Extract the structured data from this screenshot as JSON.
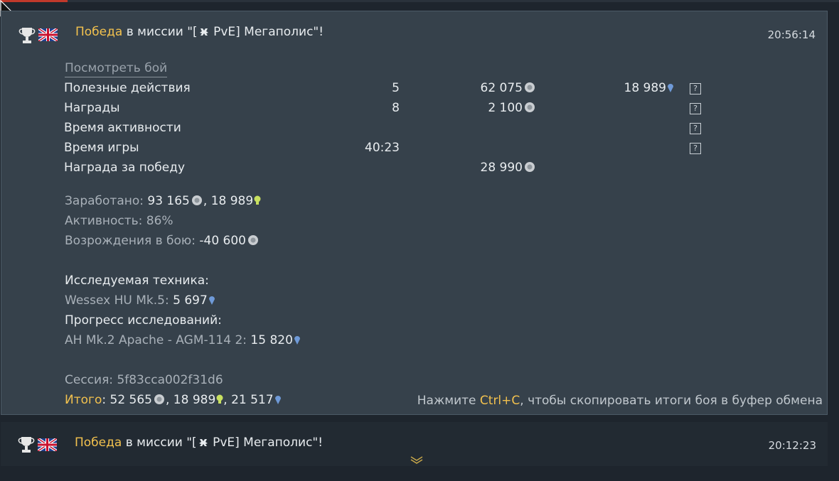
{
  "entry1": {
    "victory": "Победа",
    "mission_text": " в миссии \"[",
    "mission_name": " PvE] Мегаполис\"!",
    "time": "20:56:14",
    "view_battle": "Посмотреть бой",
    "rows": [
      {
        "label": "Полезные действия",
        "count": "5",
        "silver": "62 075",
        "rp": "18 989"
      },
      {
        "label": "Награды",
        "count": "8",
        "silver": "2 100",
        "rp": ""
      },
      {
        "label": "Время активности",
        "count": "",
        "silver": "",
        "rp": ""
      },
      {
        "label": "Время игры",
        "count": "40:23",
        "silver": "",
        "rp": ""
      },
      {
        "label": "Награда за победу",
        "count": "",
        "silver": "28 990",
        "rp": ""
      }
    ],
    "earned_label": "Заработано: ",
    "earned_silver": "93 165",
    "earned_rp": "18 989",
    "activity_label": "Активность: ",
    "activity_value": "86%",
    "respawn_label": "Возрождения в бою: ",
    "respawn_value": "-40 600",
    "research_title": "Исследуемая техника:",
    "research_vehicle": "Wessex HU Mk.5: ",
    "research_value": "5 697",
    "progress_title": "Прогресс исследований:",
    "progress_item": "AH Mk.2 Apache - AGM-114 2: ",
    "progress_value": "15 820",
    "session_label": "Сессия: ",
    "session_value": "5f83cca002f31d6",
    "total_label": "Итого",
    "total_silver": "52 565",
    "total_rp": "18 989",
    "total_crp": "21 517",
    "hint_pre": "Нажмите ",
    "hint_key": "Ctrl+C",
    "hint_post": ", чтобы скопировать итоги боя в буфер обмена"
  },
  "entry2": {
    "victory": "Победа",
    "mission_text": " в миссии \"[",
    "mission_name": " PvE] Мегаполис\"!",
    "time": "20:12:23"
  },
  "icons": [
    "trophy-icon",
    "uk-flag-icon",
    "silver-lion-icon",
    "rp-bulb-icon",
    "crp-drop-icon",
    "help-icon",
    "expand-chevron-icon"
  ],
  "colors": {
    "accent": "#f2c14e",
    "panel": "#36414b",
    "rp": "#c8e060",
    "crp": "#6f9ad8"
  }
}
